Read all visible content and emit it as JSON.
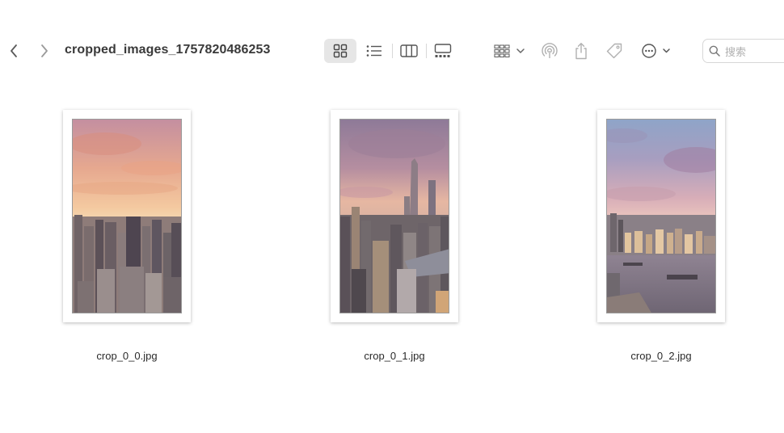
{
  "window": {
    "title": "cropped_images_1757820486253"
  },
  "toolbar": {
    "back_icon": "chevron-left-icon",
    "forward_icon": "chevron-right-icon",
    "view_modes": [
      {
        "name": "icon-view",
        "icon": "grid-icon",
        "selected": true
      },
      {
        "name": "list-view",
        "icon": "list-icon",
        "selected": false
      },
      {
        "name": "column-view",
        "icon": "columns-icon",
        "selected": false
      },
      {
        "name": "gallery-view",
        "icon": "gallery-icon",
        "selected": false
      }
    ],
    "group_icon": "group-grid-icon",
    "airdrop_icon": "airdrop-icon",
    "share_icon": "share-icon",
    "tag_icon": "tag-icon",
    "more_icon": "ellipsis-circle-icon"
  },
  "search": {
    "placeholder": "搜索"
  },
  "files": [
    {
      "name": "crop_0_0.jpg"
    },
    {
      "name": "crop_0_1.jpg"
    },
    {
      "name": "crop_0_2.jpg"
    }
  ],
  "colors": {
    "selected_bg": "#e6e6e6",
    "icon_gray": "#6e6e6e",
    "icon_light": "#b5b5b5"
  }
}
